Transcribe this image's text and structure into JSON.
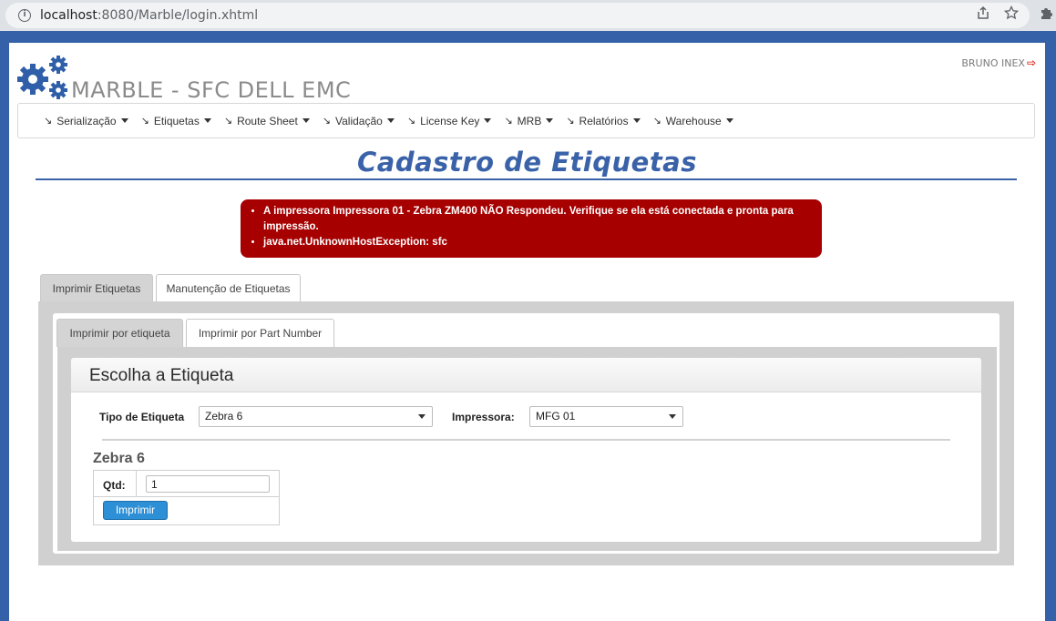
{
  "browser": {
    "url_host": "localhost",
    "url_path": ":8080/Marble/login.xhtml"
  },
  "header": {
    "brand": "MARBLE - SFC DELL EMC",
    "user": "BRUNO INEX"
  },
  "menu": [
    {
      "label": "Serialização"
    },
    {
      "label": "Etiquetas"
    },
    {
      "label": "Route Sheet"
    },
    {
      "label": "Validação"
    },
    {
      "label": "License Key"
    },
    {
      "label": "MRB"
    },
    {
      "label": "Relatórios"
    },
    {
      "label": "Warehouse"
    }
  ],
  "page_title": "Cadastro de Etiquetas",
  "errors": [
    "A impressora Impressora 01 - Zebra ZM400 NÃO Respondeu. Verifique se ela está conectada e pronta para impressão.",
    "java.net.UnknownHostException: sfc"
  ],
  "tabs": {
    "outer": [
      "Imprimir Etiquetas",
      "Manutenção de Etiquetas"
    ],
    "inner": [
      "Imprimir por etiqueta",
      "Imprimir por Part Number"
    ]
  },
  "form": {
    "card_title": "Escolha a Etiqueta",
    "tipo_label": "Tipo de Etiqueta",
    "tipo_value": "Zebra 6",
    "impressora_label": "Impressora:",
    "impressora_value": "MFG 01",
    "section_title": "Zebra 6",
    "qtd_label": "Qtd:",
    "qtd_value": "1",
    "print_button": "Imprimir"
  },
  "colors": {
    "frame_blue": "#3461a8",
    "title_blue": "#3a62a8",
    "error_red": "#a60000",
    "button_blue": "#2d8fd5"
  }
}
